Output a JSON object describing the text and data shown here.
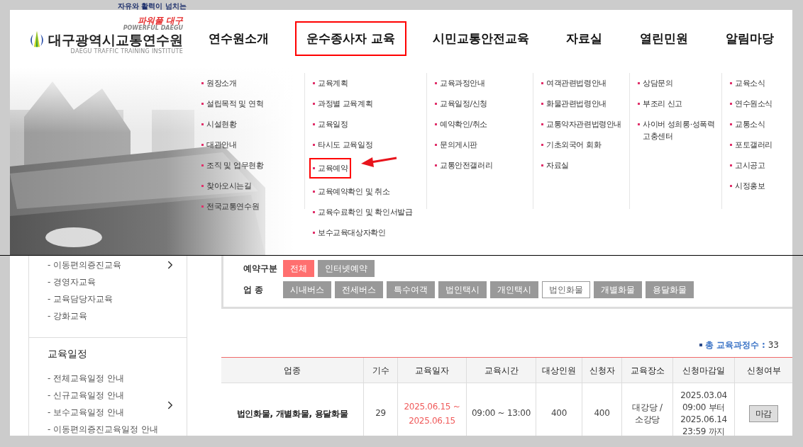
{
  "header": {
    "slogan": "자유와 활력이 넘치는",
    "slogan_brand": "파워풀 대구",
    "slogan_en": "POWERFUL DAEGU",
    "logo_name": "대구광역시교통연수원",
    "logo_en": "DAEGU TRAFFIC TRAINING INSTITUTE"
  },
  "nav": [
    {
      "label": "연수원소개",
      "highlighted": false
    },
    {
      "label": "운수종사자 교육",
      "highlighted": true
    },
    {
      "label": "시민교통안전교육",
      "highlighted": false
    },
    {
      "label": "자료실",
      "highlighted": false
    },
    {
      "label": "열린민원",
      "highlighted": false
    },
    {
      "label": "알림마당",
      "highlighted": false
    }
  ],
  "mega_menu": {
    "columns": [
      {
        "items": [
          {
            "label": "원장소개",
            "highlighted": false
          },
          {
            "label": "설립목적 및 연혁",
            "highlighted": false
          },
          {
            "label": "시설현황",
            "highlighted": false
          },
          {
            "label": "대관안내",
            "highlighted": false
          },
          {
            "label": "조직 및 업무현황",
            "highlighted": false
          },
          {
            "label": "찾아오시는길",
            "highlighted": false
          },
          {
            "label": "전국교통연수원",
            "highlighted": false
          }
        ]
      },
      {
        "items": [
          {
            "label": "교육계획",
            "highlighted": false
          },
          {
            "label": "과정별 교육계획",
            "highlighted": false
          },
          {
            "label": "교육일정",
            "highlighted": false
          },
          {
            "label": "타시도 교육일정",
            "highlighted": false
          },
          {
            "label": "교육예약",
            "highlighted": true
          },
          {
            "label": "교육예약확인 및 취소",
            "highlighted": false
          },
          {
            "label": "교육수료확인 및 확인서발급",
            "highlighted": false
          },
          {
            "label": "보수교육대상자확인",
            "highlighted": false
          }
        ]
      },
      {
        "items": [
          {
            "label": "교육과정안내",
            "highlighted": false
          },
          {
            "label": "교육일정/신청",
            "highlighted": false
          },
          {
            "label": "예약확인/취소",
            "highlighted": false
          },
          {
            "label": "문의게시판",
            "highlighted": false
          },
          {
            "label": "교통안전갤러리",
            "highlighted": false
          }
        ]
      },
      {
        "items": [
          {
            "label": "여객관련법령안내",
            "highlighted": false
          },
          {
            "label": "화물관련법령안내",
            "highlighted": false
          },
          {
            "label": "교통약자관련법령안내",
            "highlighted": false
          },
          {
            "label": "기초외국어 회화",
            "highlighted": false
          },
          {
            "label": "자료실",
            "highlighted": false
          }
        ]
      },
      {
        "items": [
          {
            "label": "상담문의",
            "highlighted": false
          },
          {
            "label": "부조리 신고",
            "highlighted": false
          },
          {
            "label": "사이버 성희롱·성폭력 고충센터",
            "highlighted": false
          }
        ]
      },
      {
        "items": [
          {
            "label": "교육소식",
            "highlighted": false
          },
          {
            "label": "연수원소식",
            "highlighted": false
          },
          {
            "label": "교통소식",
            "highlighted": false
          },
          {
            "label": "포토갤러리",
            "highlighted": false
          },
          {
            "label": "고시공고",
            "highlighted": false
          },
          {
            "label": "시정홍보",
            "highlighted": false
          }
        ]
      }
    ]
  },
  "sidebar": {
    "groups": [
      {
        "items": [
          "- 이동편의증진교육",
          "- 경영자교육",
          "- 교육담당자교육",
          "- 강화교육"
        ]
      },
      {
        "title": "교육일정",
        "items": [
          "- 전체교육일정 안내",
          "- 신규교육일정 안내",
          "- 보수교육일정 안내",
          "- 이동편의증진교육일정 안내"
        ]
      }
    ]
  },
  "filter": {
    "rows": [
      {
        "label": "예약구분",
        "kind": "filled",
        "options": [
          {
            "label": "전체",
            "selected": true
          },
          {
            "label": "인터넷예약",
            "selected": false
          }
        ]
      },
      {
        "label": "업 종",
        "kind": "outlined",
        "options": [
          {
            "label": "시내버스",
            "selected": false
          },
          {
            "label": "전세버스",
            "selected": false
          },
          {
            "label": "특수여객",
            "selected": false
          },
          {
            "label": "법인택시",
            "selected": false
          },
          {
            "label": "개인택시",
            "selected": false
          },
          {
            "label": "법인화물",
            "selected": true
          },
          {
            "label": "개별화물",
            "selected": false
          },
          {
            "label": "용달화물",
            "selected": false
          }
        ]
      }
    ]
  },
  "total": {
    "label": "총 교육과정수 :",
    "value": "33"
  },
  "table": {
    "columns": [
      "업종",
      "기수",
      "교육일자",
      "교육시간",
      "대상인원",
      "신청자",
      "교육장소",
      "신청마감일",
      "신청여부"
    ],
    "rows": [
      {
        "cells": [
          {
            "kind": "bold",
            "text": "법인화물, 개별화물, 용달화물"
          },
          {
            "kind": "text",
            "text": "29"
          },
          {
            "kind": "date",
            "text": "2025.06.15 ~ 2025.06.15"
          },
          {
            "kind": "text",
            "text": "09:00 ~ 13:00"
          },
          {
            "kind": "text",
            "text": "400"
          },
          {
            "kind": "text",
            "text": "400"
          },
          {
            "kind": "text",
            "text": "대강당 / 소강당"
          },
          {
            "kind": "text",
            "text": "2025.03.04 09:00 부터 2025.06.14 23:59 까지"
          },
          {
            "kind": "button",
            "text": "마감"
          }
        ]
      }
    ]
  }
}
